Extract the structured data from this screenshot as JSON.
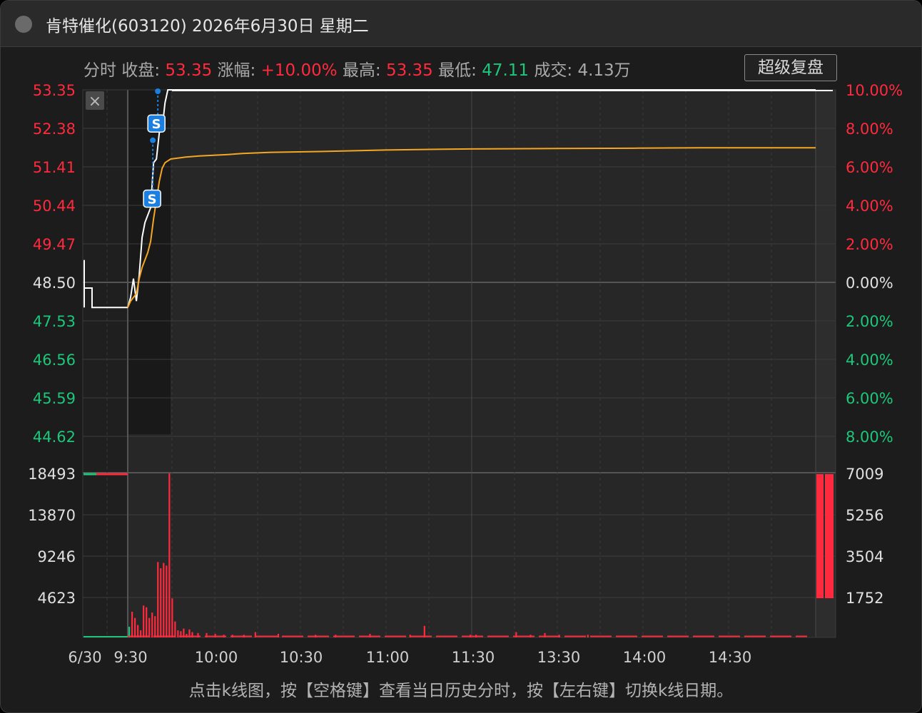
{
  "window": {
    "title": "肯特催化(603120) 2026年6月30日 星期二"
  },
  "info": {
    "label_mode": "分时",
    "label_close": "收盘:",
    "close": "53.35",
    "label_change": "涨幅:",
    "change": "+10.00%",
    "label_high": "最高:",
    "high": "53.35",
    "label_low": "最低:",
    "low": "47.11",
    "label_volume": "成交:",
    "volume": "4.13万"
  },
  "buttons": {
    "replay": "超级复盘",
    "close_panel": "×"
  },
  "hint": "点击k线图，按【空格键】查看当日历史分时，按【左右键】切换k线日期。",
  "colors": {
    "up": "#ff2a3d",
    "down": "#1cc77a",
    "price_line": "#ffffff",
    "avg_line": "#f5a623",
    "marker": "#1a7fe0"
  },
  "chart_data": {
    "type": "line",
    "prev_close": 48.5,
    "price_axis": {
      "labels": [
        "53.35",
        "52.38",
        "51.41",
        "50.44",
        "49.47",
        "48.50",
        "47.53",
        "46.56",
        "45.59",
        "44.62"
      ],
      "range": [
        44.14,
        53.35
      ]
    },
    "percent_axis": {
      "labels": [
        "10.00%",
        "8.00%",
        "6.00%",
        "4.00%",
        "2.00%",
        "0.00%",
        "2.00%",
        "4.00%",
        "6.00%",
        "8.00%"
      ]
    },
    "volume_axis": {
      "left_labels": [
        "18493",
        "13870",
        "9246",
        "4623"
      ],
      "right_labels": [
        "7009",
        "5256",
        "3504",
        "1752"
      ],
      "max": 18493
    },
    "time_labels": [
      "6/30",
      "9:30",
      "10:00",
      "10:30",
      "11:00",
      "11:30",
      "13:30",
      "14:00",
      "14:30"
    ],
    "preauction": {
      "x_minutes": [
        0,
        0.3,
        2.5,
        2.6,
        5.0
      ],
      "price": [
        48.8,
        48.0,
        48.0,
        47.55,
        47.55
      ]
    },
    "series": [
      {
        "name": "价格",
        "x_minutes": [
          0,
          1,
          2,
          3,
          4,
          5,
          6,
          7,
          8,
          9,
          10,
          11,
          12,
          13,
          14,
          15,
          240
        ],
        "values": [
          47.53,
          47.8,
          48.3,
          47.7,
          48.4,
          49.4,
          49.8,
          50.0,
          50.2,
          51.4,
          51.5,
          52.2,
          52.3,
          53.0,
          53.35,
          53.35,
          53.35
        ]
      },
      {
        "name": "均价",
        "x_minutes": [
          0,
          1,
          2,
          3,
          4,
          5,
          6,
          7,
          8,
          9,
          10,
          11,
          12,
          13,
          14,
          15,
          20,
          25,
          30,
          35,
          40,
          50,
          67,
          78,
          90,
          108,
          120,
          150,
          178,
          200,
          225,
          240
        ],
        "values": [
          47.53,
          47.7,
          47.8,
          47.9,
          48.3,
          48.6,
          48.8,
          49.0,
          49.3,
          49.9,
          50.4,
          50.9,
          51.25,
          51.4,
          51.45,
          51.5,
          51.55,
          51.58,
          51.6,
          51.62,
          51.65,
          51.68,
          51.7,
          51.72,
          51.74,
          51.76,
          51.77,
          51.78,
          51.79,
          51.8,
          51.8,
          51.8
        ]
      }
    ],
    "volume": {
      "x_minutes": [
        0,
        1,
        2,
        3,
        4,
        5,
        6,
        7,
        8,
        9,
        10,
        11,
        12,
        13,
        14,
        15,
        16,
        17,
        18,
        19,
        20,
        21,
        22,
        24,
        27,
        30,
        33,
        36,
        40,
        44,
        52,
        65,
        72,
        84,
        98,
        103,
        119,
        121,
        135,
        140,
        145,
        150,
        160
      ],
      "values": [
        1200,
        2900,
        2200,
        1400,
        800,
        3600,
        3400,
        2200,
        2800,
        2400,
        8500,
        7800,
        8400,
        8100,
        18493,
        4400,
        1800,
        800,
        700,
        1000,
        400,
        900,
        600,
        500,
        500,
        400,
        300,
        300,
        300,
        600,
        400,
        300,
        300,
        400,
        300,
        1300,
        300,
        300,
        600,
        300,
        500,
        300,
        300
      ],
      "colors": [
        "g",
        "r",
        "r",
        "r",
        "r",
        "r",
        "r",
        "r",
        "r",
        "r",
        "r",
        "r",
        "r",
        "r",
        "r",
        "r",
        "r",
        "r",
        "r",
        "r",
        "r",
        "r",
        "r",
        "r",
        "r",
        "r",
        "r",
        "r",
        "r",
        "r",
        "r",
        "r",
        "r",
        "r",
        "r",
        "r",
        "r",
        "r",
        "r",
        "r",
        "r",
        "r",
        "r"
      ],
      "auction_bar": 5256
    },
    "events": [
      {
        "label": "S",
        "x_minute": 9,
        "price": 50.44
      },
      {
        "label": "S",
        "x_minute": 10,
        "price": 52.45
      }
    ]
  }
}
